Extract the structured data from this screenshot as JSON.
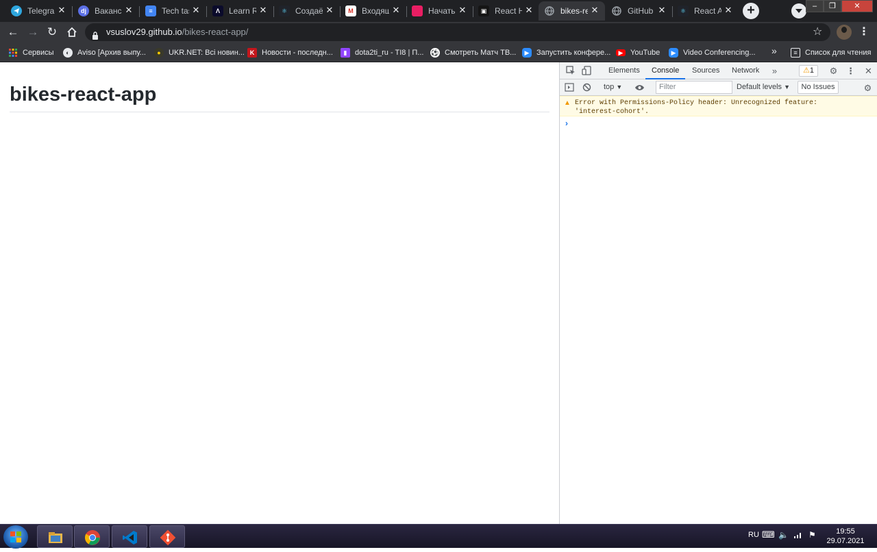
{
  "tabs": [
    {
      "title": "Telegram",
      "icon": "telegram-icon",
      "color": "#2ea6de"
    },
    {
      "title": "Вакансии",
      "icon": "djinni-icon",
      "color": "#5b6fe6"
    },
    {
      "title": "Tech task",
      "icon": "docs-icon",
      "color": "#4285f4"
    },
    {
      "title": "Learn React",
      "icon": "learn-icon",
      "color": "#0b0b2b"
    },
    {
      "title": "Создаём",
      "icon": "react-icon",
      "color": "#20232a"
    },
    {
      "title": "Входящие",
      "icon": "gmail-icon",
      "color": "#ffffff"
    },
    {
      "title": "Начать",
      "icon": "page-icon",
      "color": "#e91e63"
    },
    {
      "title": "React Hooks",
      "icon": "codesandbox-icon",
      "color": "#151515"
    },
    {
      "title": "bikes-react-app",
      "icon": "globe-icon",
      "color": "#9aa0a6",
      "active": true
    },
    {
      "title": "GitHub Pages",
      "icon": "globe-icon",
      "color": "#9aa0a6"
    },
    {
      "title": "React App",
      "icon": "react-icon",
      "color": "#20232a"
    }
  ],
  "address": {
    "host": "vsuslov29.github.io",
    "path": "/bikes-react-app/"
  },
  "bookmarks": [
    {
      "label": "Сервисы",
      "icon": "apps-grid-icon"
    },
    {
      "label": "Aviso [Архив выпу...",
      "icon": "aviso-icon"
    },
    {
      "label": "UKR.NET: Всі новин...",
      "icon": "ukrnet-icon"
    },
    {
      "label": "Новости - последн...",
      "icon": "k-icon"
    },
    {
      "label": "dota2ti_ru - TI8 | П...",
      "icon": "twitch-icon"
    },
    {
      "label": "Смотреть Матч ТВ...",
      "icon": "ball-icon"
    },
    {
      "label": "Запустить конфере...",
      "icon": "zoom-icon"
    },
    {
      "label": "YouTube",
      "icon": "youtube-icon"
    },
    {
      "label": "Video Conferencing...",
      "icon": "zoom-icon"
    }
  ],
  "reading_list": "Список для чтения",
  "page": {
    "heading": "bikes-react-app"
  },
  "devtools": {
    "tabs": [
      "Elements",
      "Console",
      "Sources",
      "Network"
    ],
    "active_tab": "Console",
    "warnings_count": "1",
    "context": "top",
    "filter_placeholder": "Filter",
    "levels": "Default levels",
    "issues": "No Issues",
    "message": "Error with Permissions-Policy header: Unrecognized feature: 'interest-cohort'."
  },
  "taskbar": {
    "language": "RU",
    "time": "19:55",
    "date": "29.07.2021"
  }
}
